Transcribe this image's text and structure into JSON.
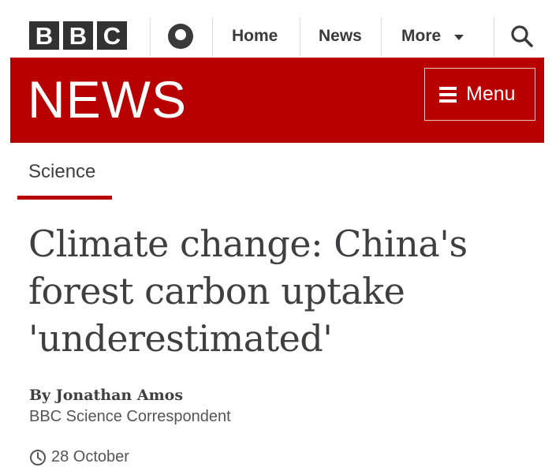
{
  "header": {
    "logo_letters": [
      "B",
      "B",
      "C"
    ],
    "nav": {
      "home_label": "Home",
      "news_label": "News",
      "more_label": "More"
    },
    "icons": {
      "account": "account-icon",
      "search": "search-icon",
      "more_caret": "chevron-down-icon"
    }
  },
  "banner": {
    "title": "NEWS",
    "menu_label": "Menu",
    "color": "#b80000"
  },
  "article": {
    "section": "Science",
    "headline": "Climate change: China's forest carbon uptake 'underestimated'",
    "author": "By Jonathan Amos",
    "author_role": "BBC Science Correspondent",
    "date": "28 October"
  },
  "colors": {
    "brand_red": "#b80000",
    "logo_block": "#323232",
    "text": "#3f3f42"
  }
}
